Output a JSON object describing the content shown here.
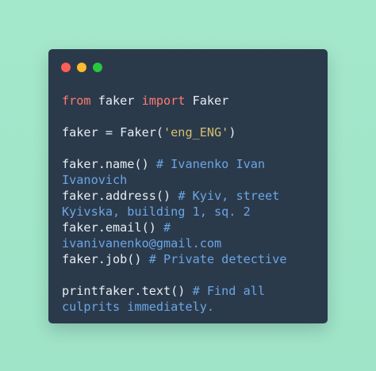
{
  "window": {
    "controls": {
      "close": "close",
      "minimize": "minimize",
      "maximize": "maximize"
    }
  },
  "code": {
    "line1": {
      "kw1": "from",
      "t1": " faker ",
      "kw2": "import",
      "t2": " Faker"
    },
    "line2": {
      "t1": "faker = Faker(",
      "str": "'eng_ENG'",
      "t2": ")"
    },
    "line3": {
      "t1": "faker.name() ",
      "cm": "# Ivanenko Ivan"
    },
    "line3b": {
      "cm": "Ivanovich"
    },
    "line4": {
      "t1": "faker.address() ",
      "cm": "# Kyiv, street"
    },
    "line4b": {
      "cm": "Kyivska, building 1, sq. 2"
    },
    "line5": {
      "t1": "faker.email() ",
      "cm": "#"
    },
    "line5b": {
      "cm": "ivanivanenko@gmail.com"
    },
    "line6": {
      "t1": "faker.job() ",
      "cm": "# Private detective"
    },
    "line7": {
      "t1": "printfaker.text() ",
      "cm": "# Find all"
    },
    "line7b": {
      "cm": "culprits immediately."
    }
  },
  "colors": {
    "background": "#a4e8cc",
    "window": "#2b3a4b",
    "text": "#e6edf3",
    "keyword": "#ff7b72",
    "string": "#d1c16e",
    "comment": "#6aa6e6",
    "dot_red": "#fc5f57",
    "dot_yellow": "#fdbc2e",
    "dot_green": "#28c840"
  }
}
